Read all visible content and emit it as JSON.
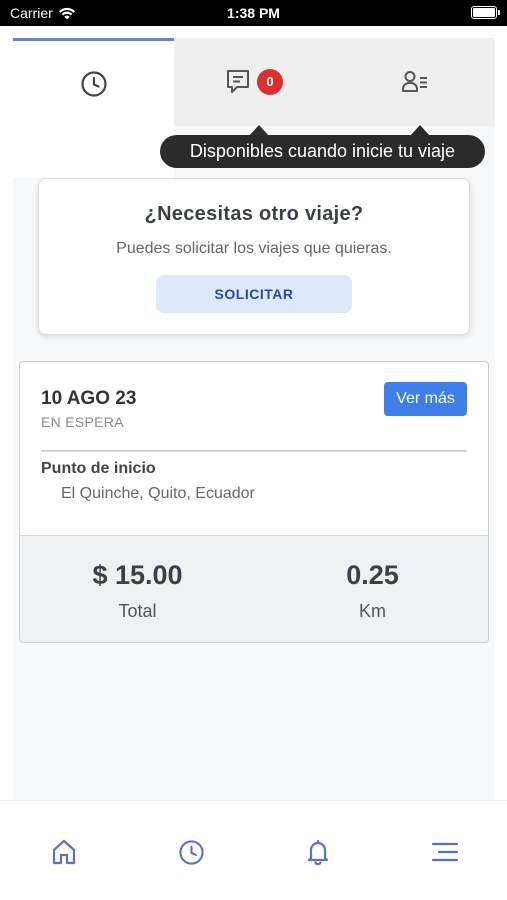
{
  "status_bar": {
    "carrier": "Carrier",
    "time": "1:38 PM"
  },
  "tabs": {
    "active": "history",
    "items": [
      {
        "id": "history",
        "icon": "clock-icon"
      },
      {
        "id": "chat",
        "icon": "chat-icon",
        "badge": "0"
      },
      {
        "id": "profile",
        "icon": "profile-list-icon"
      }
    ]
  },
  "tooltip": {
    "text": "Disponibles cuando inicie tu viaje"
  },
  "request_card": {
    "title": "¿Necesitas otro viaje?",
    "subtitle": "Puedes solicitar los viajes que quieras.",
    "button_label": "SOLICITAR"
  },
  "trip": {
    "date": "10 AGO 23",
    "status": "EN ESPERA",
    "more_label": "Ver más",
    "start_label": "Punto de inicio",
    "start_value": "El Quinche, Quito, Ecuador",
    "total_value": "$ 15.00",
    "total_label": "Total",
    "distance_value": "0.25",
    "distance_label": "Km"
  },
  "bottom_nav": {
    "items": [
      {
        "id": "home",
        "icon": "home-icon"
      },
      {
        "id": "history",
        "icon": "clock-icon"
      },
      {
        "id": "notifications",
        "icon": "bell-icon"
      },
      {
        "id": "menu",
        "icon": "menu-icon"
      }
    ]
  },
  "colors": {
    "accent": "#6b7fd7",
    "primary_button": "#3e7ee8",
    "badge": "#dc2f2f",
    "tooltip_bg": "#2b2b2b",
    "nav_icon": "#5b6fd0"
  }
}
